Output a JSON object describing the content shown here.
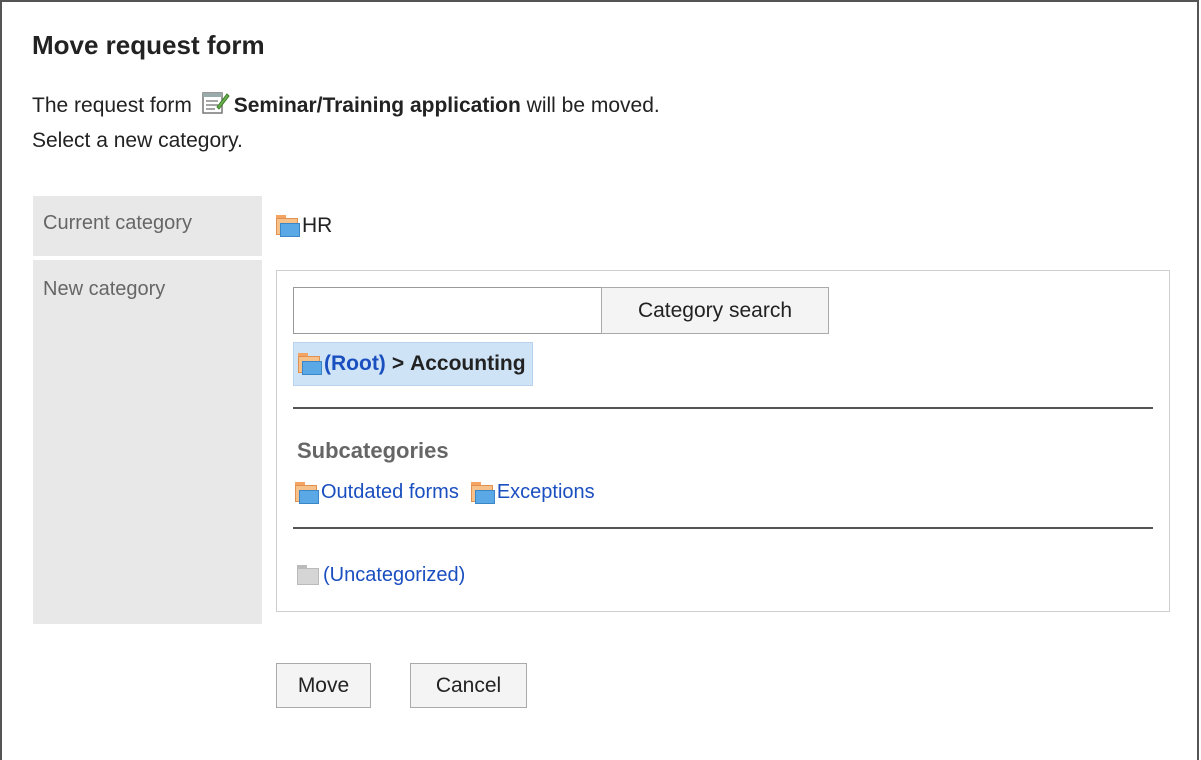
{
  "dialog": {
    "title": "Move request form",
    "desc_prefix": "The request form",
    "form_name": "Seminar/Training application",
    "desc_suffix": "will be moved.",
    "desc_line2": "Select a new category."
  },
  "current_category": {
    "label": "Current category",
    "value": "HR",
    "icon": "folder-icon"
  },
  "new_category": {
    "label": "New category",
    "search": {
      "value": "",
      "placeholder": "",
      "button_label": "Category search"
    },
    "breadcrumb": {
      "root_label": "(Root)",
      "separator": ">",
      "current": "Accounting"
    },
    "subcategories": {
      "heading": "Subcategories",
      "items": [
        {
          "label": "Outdated forms",
          "icon": "folder-icon"
        },
        {
          "label": "Exceptions",
          "icon": "folder-icon"
        }
      ]
    },
    "uncategorized": {
      "label": "(Uncategorized)",
      "icon": "gray-folder-icon"
    }
  },
  "actions": {
    "move_label": "Move",
    "cancel_label": "Cancel"
  },
  "colors": {
    "link": "#1a4fc0",
    "label_bg": "#e8e8e8",
    "selected_bg": "#cfe3f7"
  }
}
